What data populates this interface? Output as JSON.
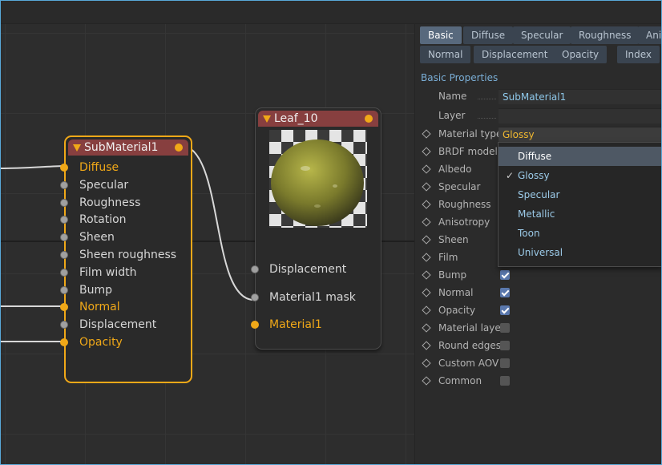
{
  "nodes": {
    "submaterial": {
      "title": "SubMaterial1",
      "inputs": [
        {
          "label": "Diffuse",
          "connected": true
        },
        {
          "label": "Specular",
          "connected": false
        },
        {
          "label": "Roughness",
          "connected": false
        },
        {
          "label": "Rotation",
          "connected": false
        },
        {
          "label": "Sheen",
          "connected": false
        },
        {
          "label": "Sheen roughness",
          "connected": false
        },
        {
          "label": "Film width",
          "connected": false
        },
        {
          "label": "Bump",
          "connected": false
        },
        {
          "label": "Normal",
          "connected": true
        },
        {
          "label": "Displacement",
          "connected": false
        },
        {
          "label": "Opacity",
          "connected": true
        }
      ]
    },
    "leaf": {
      "title": "Leaf_10",
      "inputs": [
        {
          "label": "Displacement",
          "connected": false
        },
        {
          "label": "Material1 mask",
          "connected": false
        },
        {
          "label": "Material1",
          "connected": true
        }
      ]
    }
  },
  "panel": {
    "tabs_row1": [
      "Basic",
      "Diffuse",
      "Specular",
      "Roughness",
      "Ani"
    ],
    "tabs_row2": [
      "Normal",
      "Displacement",
      "Opacity",
      "Index"
    ],
    "active_tab": "Basic",
    "section_title": "Basic Properties",
    "name": {
      "label": "Name",
      "value": "SubMaterial1"
    },
    "layer": {
      "label": "Layer",
      "value": ""
    },
    "material_type": {
      "label": "Material type",
      "value": "Glossy"
    },
    "rows": [
      {
        "label": "BRDF model",
        "checked": null
      },
      {
        "label": "Albedo",
        "checked": null
      },
      {
        "label": "Specular",
        "checked": null
      },
      {
        "label": "Roughness",
        "checked": null
      },
      {
        "label": "Anisotropy",
        "checked": null
      },
      {
        "label": "Sheen",
        "checked": null
      },
      {
        "label": "Film",
        "checked": null
      },
      {
        "label": "Bump",
        "checked": true
      },
      {
        "label": "Normal",
        "checked": true
      },
      {
        "label": "Opacity",
        "checked": true
      },
      {
        "label": "Material layer",
        "checked": false
      },
      {
        "label": "Round edges",
        "checked": false
      },
      {
        "label": "Custom AOV",
        "checked": false
      },
      {
        "label": "Common",
        "checked": false
      }
    ]
  },
  "dropdown": {
    "options": [
      "Diffuse",
      "Glossy",
      "Specular",
      "Metallic",
      "Toon",
      "Universal"
    ],
    "selected": "Glossy",
    "hovered": "Diffuse",
    "check_glyph": "✓"
  },
  "colors": {
    "accent": "#f0a818",
    "node_header": "#873f3f",
    "tab_active": "#58697d",
    "tab": "#3a4450",
    "link_text": "#7aaed6"
  }
}
